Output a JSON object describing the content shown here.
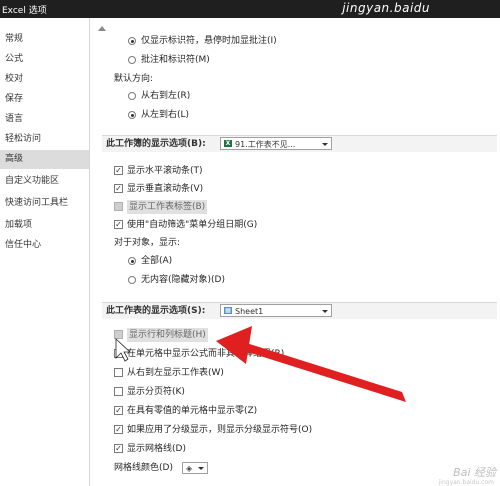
{
  "window": {
    "title": "Excel 选项",
    "watermark_top": "jingyan.baidu"
  },
  "sidebar": {
    "items": [
      {
        "label": "常规"
      },
      {
        "label": "公式"
      },
      {
        "label": "校对"
      },
      {
        "label": "保存"
      },
      {
        "label": "语言"
      },
      {
        "label": "轻松访问"
      },
      {
        "label": "高级",
        "selected": true
      },
      {
        "label": "自定义功能区"
      },
      {
        "label": "快速访问工具栏"
      },
      {
        "label": "加载项"
      },
      {
        "label": "信任中心"
      }
    ]
  },
  "comments": {
    "opt_indicator_only": "仅显示标识符，悬停时加显批注(I)",
    "opt_comments_and_indicators": "批注和标识符(M)"
  },
  "direction": {
    "label": "默认方向:",
    "rtl": "从右到左(R)",
    "ltr": "从左到右(L)"
  },
  "workbook_section": {
    "title": "此工作簿的显示选项(B):",
    "selected": "91.工作表不见...",
    "options": {
      "hscroll": "显示水平滚动条(T)",
      "vscroll": "显示垂直滚动条(V)",
      "sheet_tabs": "显示工作表标签(B)",
      "autofilter_dates": "使用\"自动筛选\"菜单分组日期(G)"
    },
    "objects_label": "对于对象，显示:",
    "all": "全部(A)",
    "nothing": "无内容(隐藏对象)(D)"
  },
  "worksheet_section": {
    "title": "此工作表的显示选项(S):",
    "selected": "Sheet1",
    "options": {
      "headers": "显示行和列标题(H)",
      "formulas": "在单元格中显示公式而非其计算结果(R)",
      "rtl_sheet": "从右到左显示工作表(W)",
      "page_breaks": "显示分页符(K)",
      "zero_values": "在具有零值的单元格中显示零(Z)",
      "outline_symbols": "如果应用了分级显示，则显示分级显示符号(O)",
      "gridlines": "显示网格线(D)"
    },
    "gridline_color_label": "网格线颜色(D)"
  },
  "watermark_bottom": {
    "main": "Bai 经验",
    "sub": "jingyan.baidu.com"
  },
  "colors": {
    "arrow": "#e02020",
    "selected_nav": "#dcdcdc",
    "excel_green": "#207245"
  },
  "icons": {
    "excel_file": "excel-file-icon",
    "sheet": "sheet-icon",
    "paint_bucket": "paint-bucket-icon",
    "annotation_arrow": "red-arrow-icon"
  }
}
